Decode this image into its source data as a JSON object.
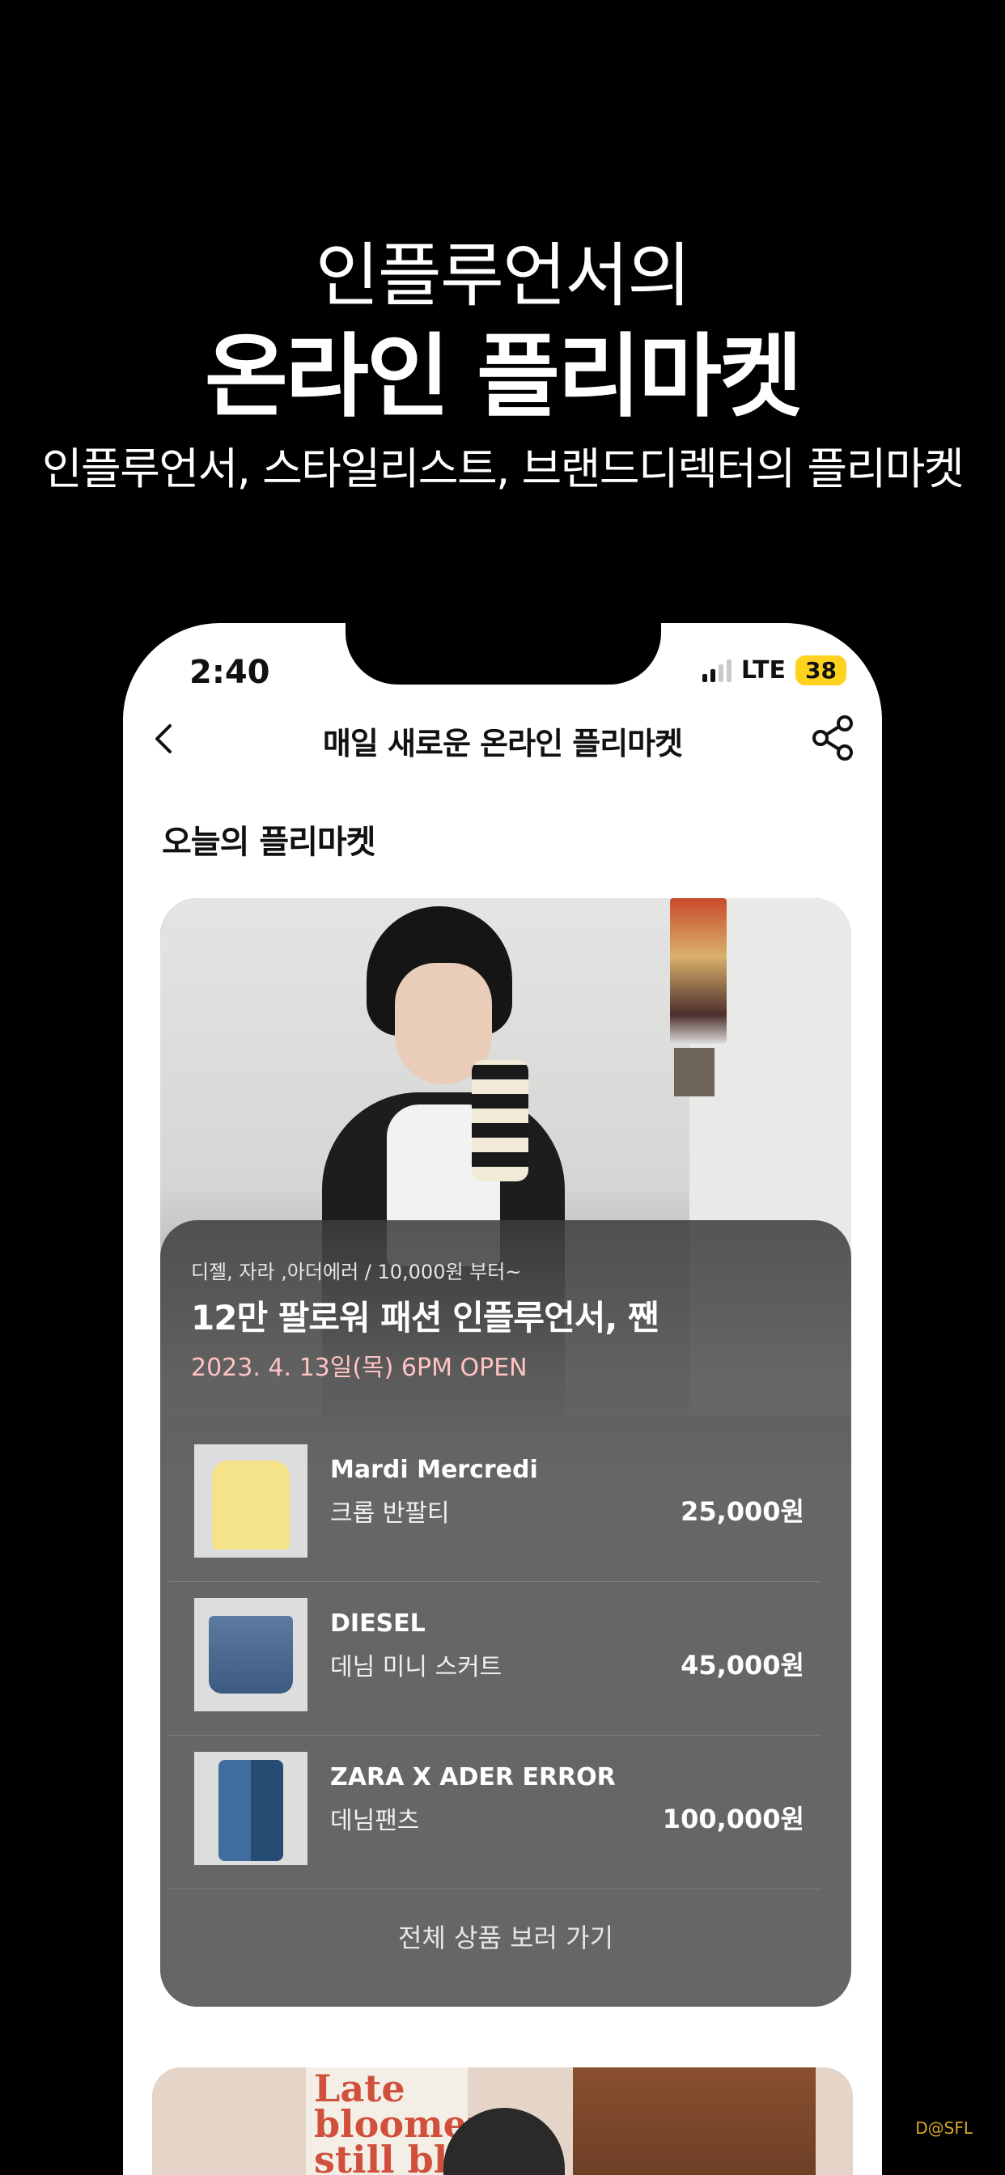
{
  "hero": {
    "line1": "인플루언서의",
    "line2": "온라인 플리마켓",
    "subtitle": "인플루언서, 스타일리스트, 브랜드디렉터의 플리마켓"
  },
  "status_bar": {
    "time": "2:40",
    "network": "LTE",
    "battery": "38"
  },
  "nav": {
    "title": "매일 새로운 온라인 플리마켓",
    "back_icon": "chevron-left-icon",
    "share_icon": "share-icon"
  },
  "section": {
    "title": "오늘의 플리마켓"
  },
  "market": {
    "tags": "디젤, 자라 ,아더에러 / 10,000원 부터~",
    "headline": "12만 팔로워 패션 인플루언서, 짼",
    "open_date": "2023. 4. 13일(목) 6PM OPEN",
    "products": [
      {
        "brand": "Mardi Mercredi",
        "name": "크롭 반팔티",
        "price": "25,000원"
      },
      {
        "brand": "DIESEL",
        "name": "데님 미니 스커트",
        "price": "45,000원"
      },
      {
        "brand": "ZARA X ADER ERROR",
        "name": "데님팬츠",
        "price": "100,000원"
      }
    ],
    "view_all": "전체 상품 보러 가기"
  },
  "second_card": {
    "book_text": "Late bloomers still blo"
  },
  "watermark": "D@SFL",
  "colors": {
    "background": "#000000",
    "battery": "#ffd21f",
    "open_date": "#ffc3c3",
    "card_overlay": "#666666"
  }
}
